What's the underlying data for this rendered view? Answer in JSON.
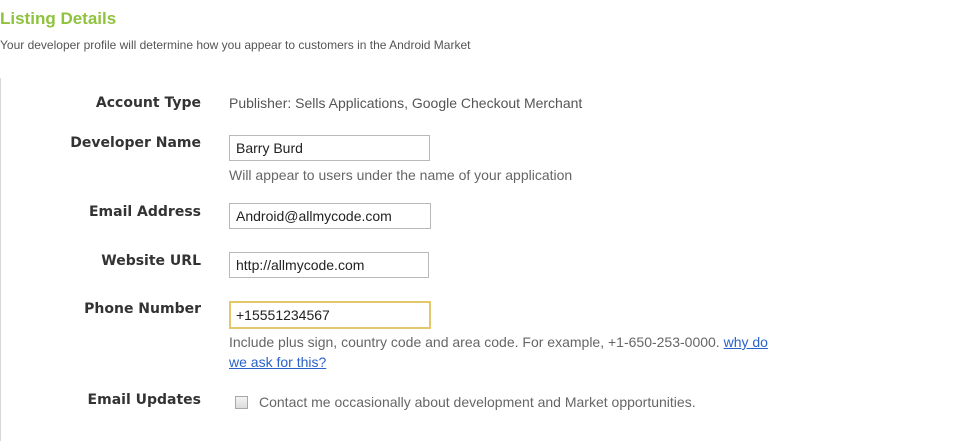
{
  "section": {
    "title": "Listing Details",
    "subtitle": "Your developer profile will determine how you appear to customers in the Android Market"
  },
  "form": {
    "account_type": {
      "label": "Account Type",
      "value": "Publisher: Sells Applications, Google Checkout Merchant"
    },
    "developer_name": {
      "label": "Developer Name",
      "value": "Barry Burd",
      "hint": "Will appear to users under the name of your application"
    },
    "email_address": {
      "label": "Email Address",
      "value": "Android@allmycode.com"
    },
    "website_url": {
      "label": "Website URL",
      "value": "http://allmycode.com"
    },
    "phone_number": {
      "label": "Phone Number",
      "value": "+15551234567",
      "hint": "Include plus sign, country code and area code. For example, +1-650-253-0000.",
      "hint_link_line1": "why do",
      "hint_link_line2": "we ask for this?"
    },
    "email_updates": {
      "label": "Email Updates",
      "checkbox_label": "Contact me occasionally about development and Market opportunities.",
      "checked": false
    }
  },
  "colors": {
    "title": "#8fc23d",
    "link": "#2a62c9",
    "focus_border": "#e2c86a"
  }
}
